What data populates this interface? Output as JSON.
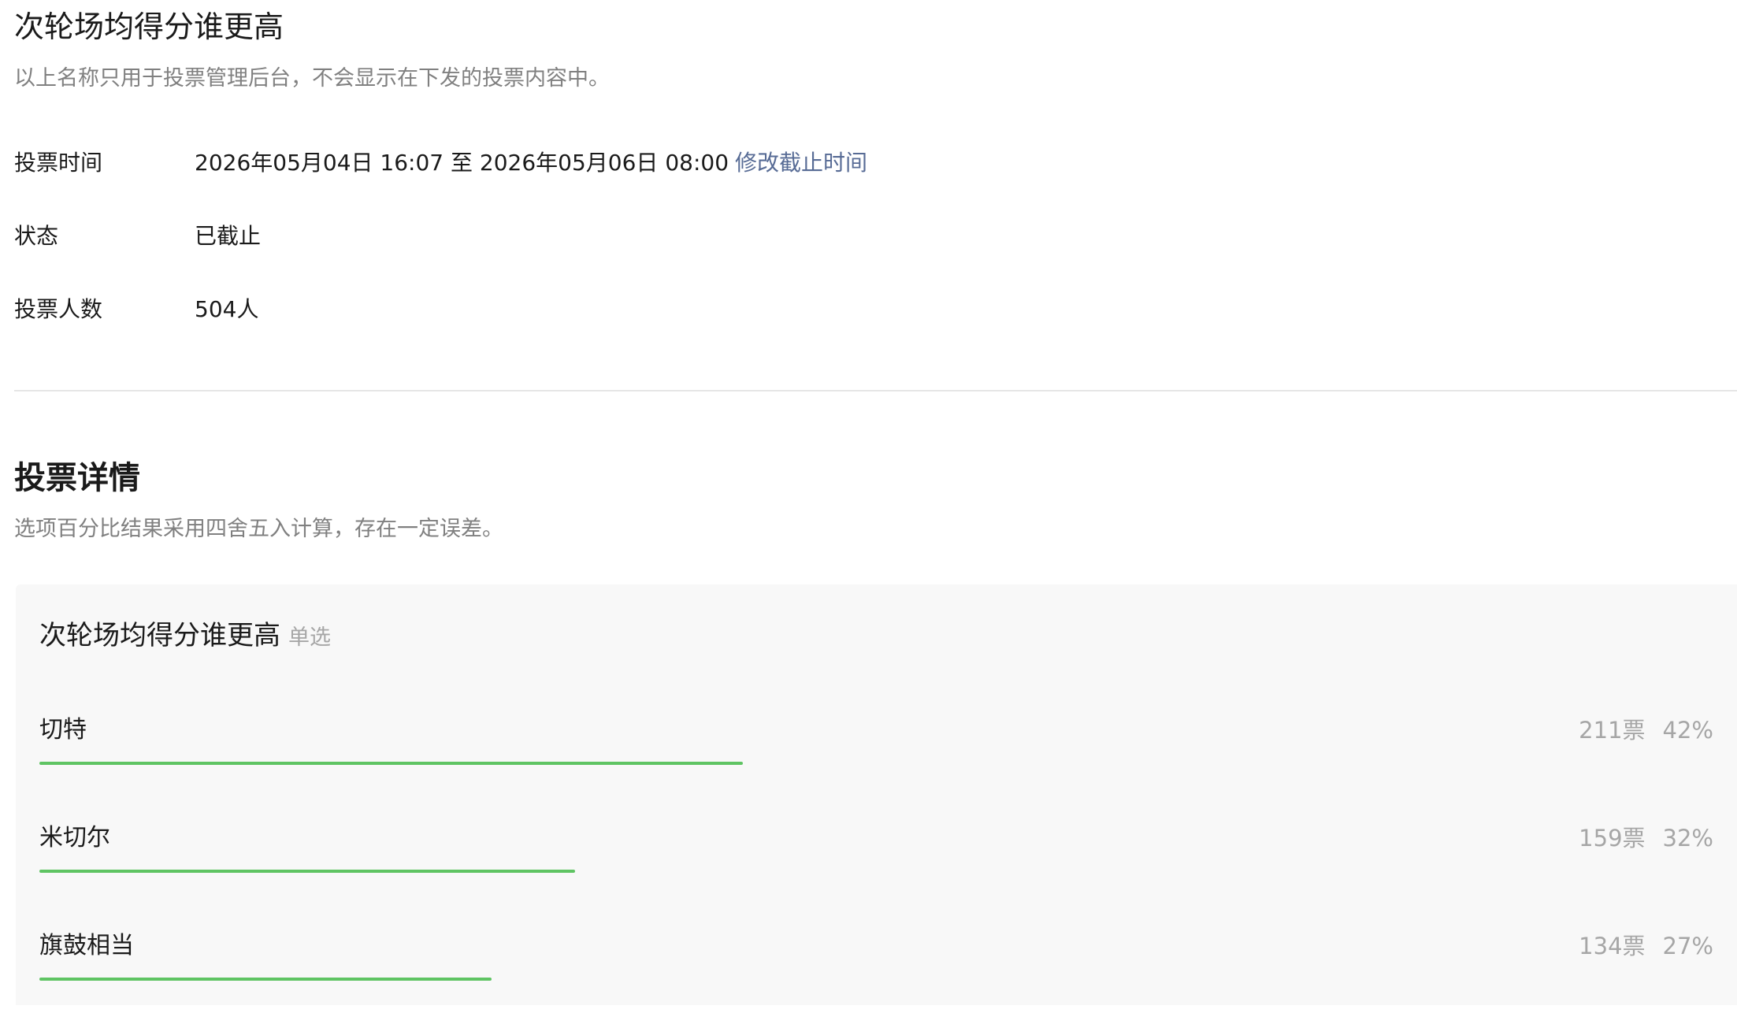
{
  "header": {
    "title": "次轮场均得分谁更高",
    "subtitle": "以上名称只用于投票管理后台，不会显示在下发的投票内容中。"
  },
  "info": {
    "time_label": "投票时间",
    "time_value": "2026年05月04日 16:07 至 2026年05月06日 08:00",
    "modify_link": "修改截止时间",
    "status_label": "状态",
    "status_value": "已截止",
    "voters_label": "投票人数",
    "voters_value": "504人"
  },
  "details": {
    "title": "投票详情",
    "subtitle": "选项百分比结果采用四舍五入计算，存在一定误差。",
    "question": "次轮场均得分谁更高",
    "question_type": "单选",
    "options": [
      {
        "label": "切特",
        "votes": "211票",
        "percent": "42%",
        "fraction": 0.42
      },
      {
        "label": "米切尔",
        "votes": "159票",
        "percent": "32%",
        "fraction": 0.32
      },
      {
        "label": "旗鼓相当",
        "votes": "134票",
        "percent": "27%",
        "fraction": 0.27
      }
    ]
  },
  "colors": {
    "bar": "#5fc463",
    "link": "#576b95"
  }
}
